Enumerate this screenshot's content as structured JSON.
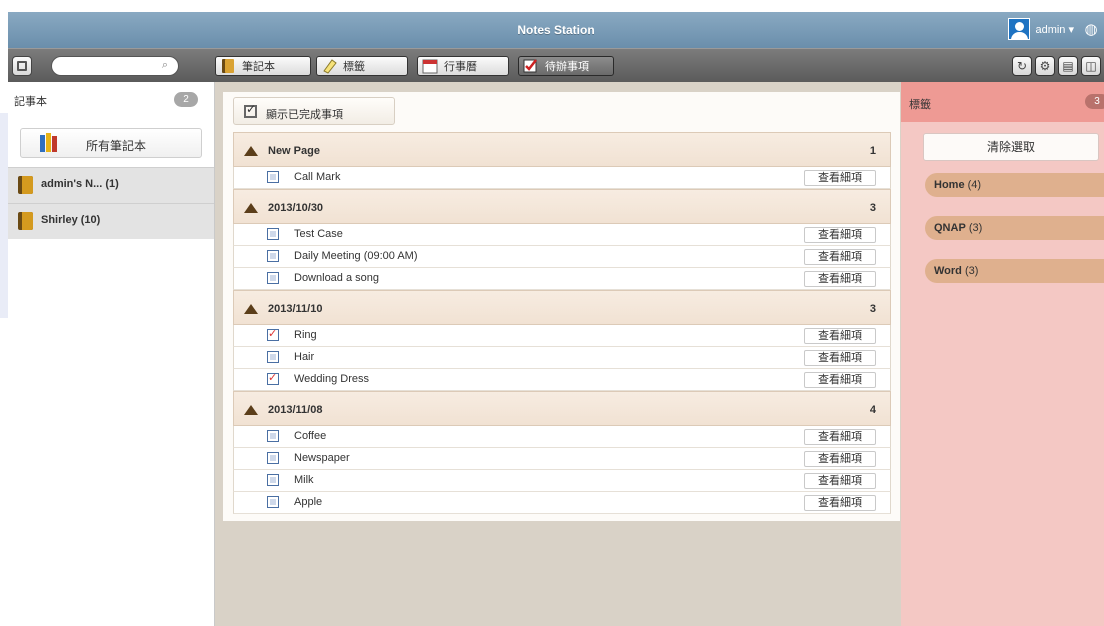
{
  "window": {
    "title": "Notes Station"
  },
  "user": {
    "name": "admin ▾"
  },
  "toolbar": {
    "search_placeholder": "",
    "nav": [
      {
        "label": "筆記本",
        "active": false
      },
      {
        "label": "標籤",
        "active": false
      },
      {
        "label": "行事曆",
        "active": false
      },
      {
        "label": "待辦事項",
        "active": true
      }
    ]
  },
  "sidebar": {
    "title": "記事本",
    "count": "2",
    "all_label": "所有筆記本",
    "notebooks": [
      {
        "label": "admin's N... (1)"
      },
      {
        "label": "Shirley (10)"
      }
    ]
  },
  "main": {
    "show_done_label": "顯示已完成事項",
    "detail_label": "查看細項",
    "groups": [
      {
        "title": "New Page",
        "count": "1",
        "items": [
          {
            "text": "Call Mark",
            "done": false
          }
        ]
      },
      {
        "title": "2013/10/30",
        "count": "3",
        "items": [
          {
            "text": "Test Case",
            "done": false
          },
          {
            "text": "Daily Meeting (09:00 AM)",
            "done": false
          },
          {
            "text": "Download a song",
            "done": false
          }
        ]
      },
      {
        "title": "2013/11/10",
        "count": "3",
        "items": [
          {
            "text": "Ring",
            "done": true
          },
          {
            "text": "Hair",
            "done": false
          },
          {
            "text": "Wedding Dress",
            "done": true
          }
        ]
      },
      {
        "title": "2013/11/08",
        "count": "4",
        "items": [
          {
            "text": "Coffee",
            "done": false
          },
          {
            "text": "Newspaper",
            "done": false
          },
          {
            "text": "Milk",
            "done": false
          },
          {
            "text": "Apple",
            "done": false
          }
        ]
      }
    ]
  },
  "tags": {
    "title": "標籤",
    "count": "3",
    "clear_label": "清除選取",
    "items": [
      {
        "name": "Home",
        "count": "(4)"
      },
      {
        "name": "QNAP",
        "count": "(3)"
      },
      {
        "name": "Word",
        "count": "(3)"
      }
    ]
  }
}
